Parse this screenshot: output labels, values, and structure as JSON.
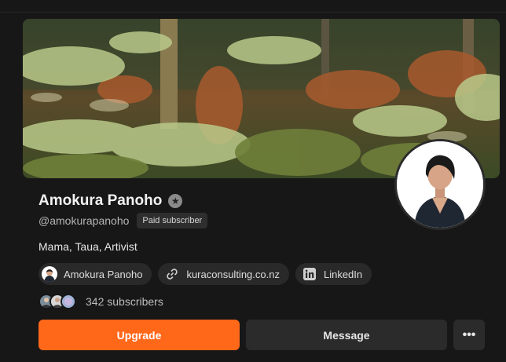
{
  "profile": {
    "name": "Amokura Panoho",
    "handle": "@amokurapanoho",
    "paid_badge": "Paid subscriber",
    "bio": "Mama, Taua, Artivist",
    "verified_icon": "star-badge-icon"
  },
  "links": [
    {
      "label": "Amokura Panoho",
      "icon": "avatar-icon"
    },
    {
      "label": "kuraconsulting.co.nz",
      "icon": "link-icon"
    },
    {
      "label": "LinkedIn",
      "icon": "linkedin-icon"
    }
  ],
  "subscribers": {
    "text": "342 subscribers"
  },
  "actions": {
    "upgrade": "Upgrade",
    "message": "Message",
    "more": "•••"
  },
  "colors": {
    "background": "#171717",
    "accent": "#ff6719",
    "button_dark": "#2b2b2b"
  }
}
